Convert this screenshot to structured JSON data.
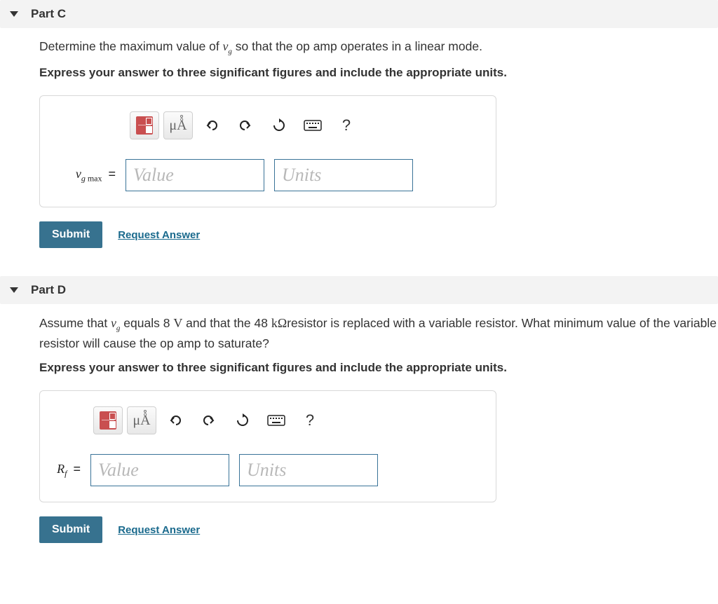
{
  "parts": {
    "c": {
      "title": "Part C",
      "question_pre": "Determine the maximum value of ",
      "question_var": "v",
      "question_var_sub": "g",
      "question_post": " so that the op amp operates in a linear mode.",
      "instruction": "Express your answer to three significant figures and include the appropriate units.",
      "label_var": "v",
      "label_sub_i": "g",
      "label_sub_w": " max",
      "value_placeholder": "Value",
      "units_placeholder": "Units",
      "units_button": "μÅ",
      "help_symbol": "?",
      "submit": "Submit",
      "request": "Request Answer"
    },
    "d": {
      "title": "Part D",
      "q1": "Assume that ",
      "q_var": "v",
      "q_var_sub": "g",
      "q2": " equals 8 ",
      "q_volt": "V",
      "q3": " and that the 48 ",
      "q_kohm": "kΩ",
      "q4": "resistor is replaced with a variable resistor. What minimum value of the variable resistor will cause the op amp to saturate?",
      "instruction": "Express your answer to three significant figures and include the appropriate units.",
      "label_var": "R",
      "label_sub_i": "f",
      "value_placeholder": "Value",
      "units_placeholder": "Units",
      "units_button": "μÅ",
      "help_symbol": "?",
      "submit": "Submit",
      "request": "Request Answer"
    }
  }
}
